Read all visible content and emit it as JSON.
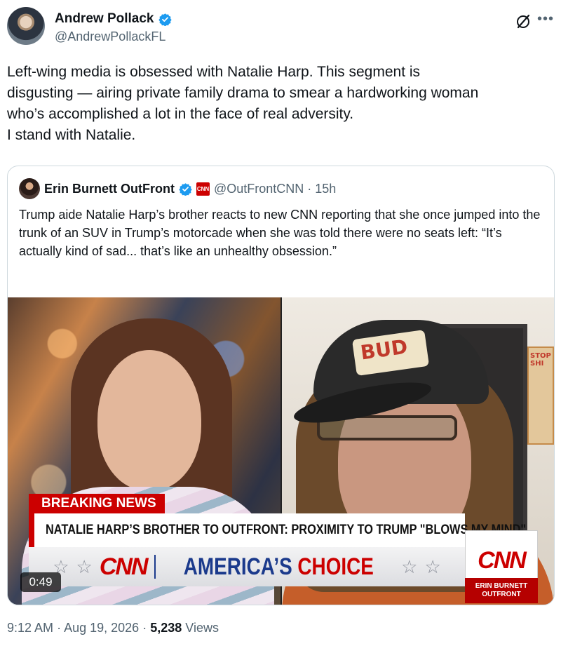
{
  "author": {
    "name": "Andrew Pollack",
    "handle": "@AndrewPollackFL",
    "verified_color": "#1d9bf0"
  },
  "tweet": {
    "text_lines": [
      "Left-wing media is obsessed with Natalie Harp. This segment is",
      "disgusting — airing private family drama to smear a hardworking woman",
      "who’s accomplished a lot in the face of real adversity.",
      "I stand with Natalie."
    ]
  },
  "quoted": {
    "name": "Erin Burnett OutFront",
    "badge": "CNN",
    "handle_time": "@OutFrontCNN · 15h",
    "text": "Trump aide Natalie Harp’s brother reacts to new CNN reporting that she once jumped into the trunk of an SUV in Trump’s motorcade when she was told there were no seats left: “It’s actually kind of sad... that’s like an unhealthy obsession.”"
  },
  "video": {
    "breaking_label": "BREAKING NEWS",
    "headline": "NATALIE HARP’S BROTHER TO OUTFRONT: PROXIMITY TO TRUMP \"BLOWS MY MIND\"",
    "banner_logo": "CNN",
    "banner_part1": "AMERICA’S",
    "banner_part2": "CHOICE",
    "corner_logo": "CNN",
    "show_name": "ERIN BURNETT OUTFRONT",
    "duration": "0:49",
    "cap_text": "BUD",
    "poster_text": "STOP SHI"
  },
  "meta": {
    "time": "9:12 AM",
    "separator": "·",
    "date": "Aug 19, 2026",
    "views_count": "5,238",
    "views_label": "Views"
  },
  "colors": {
    "verified": "#1d9bf0",
    "cnn_red": "#cc0000",
    "secondary_text": "#536471"
  }
}
